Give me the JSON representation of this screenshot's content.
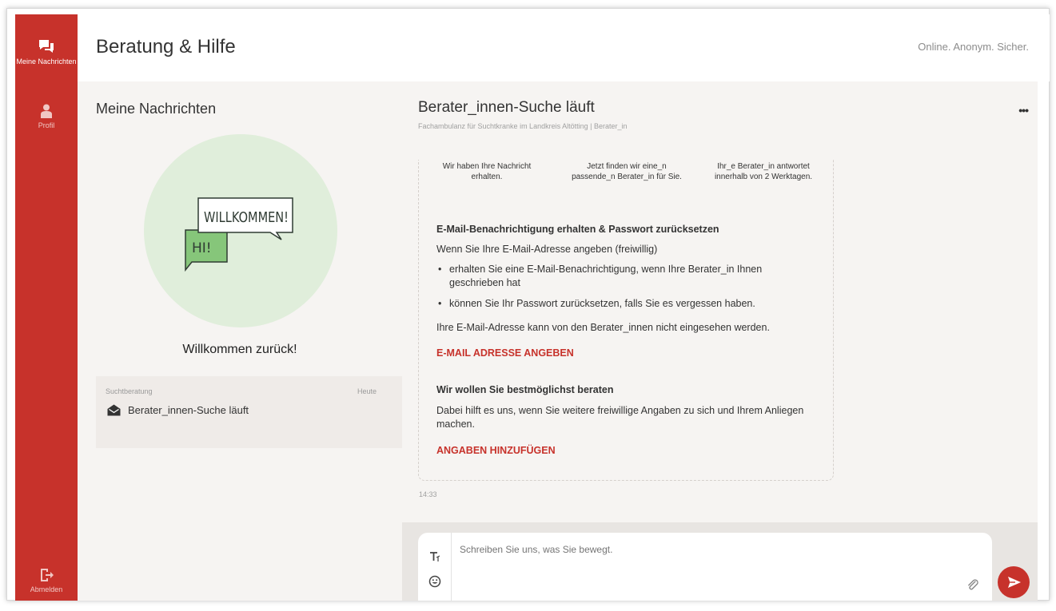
{
  "sidebar": {
    "items": [
      {
        "label": "Meine Nachrichten",
        "icon": "chat-bubbles-icon",
        "active": true
      },
      {
        "label": "Profil",
        "icon": "person-icon",
        "active": false
      }
    ],
    "logout_label": "Abmelden"
  },
  "header": {
    "title": "Beratung & Hilfe",
    "tagline": "Online. Anonym. Sicher."
  },
  "left_panel": {
    "title": "Meine Nachrichten",
    "illustration": {
      "bubble_large": "WILLKOMMEN!",
      "bubble_small": "HI!"
    },
    "welcome_text": "Willkommen zurück!",
    "session": {
      "topic": "Suchtberatung",
      "date": "Heute",
      "subject": "Berater_innen-Suche läuft"
    }
  },
  "conversation": {
    "title": "Berater_innen-Suche läuft",
    "subtitle": "Fachambulanz für Suchtkranke im Landkreis Altötting  |  Berater_in",
    "steps": [
      "Wir haben Ihre Nachricht erhalten.",
      "Jetzt finden wir eine_n passende_n Berater_in für Sie.",
      "Ihr_e Berater_in antwortet innerhalb von 2 Werktagen."
    ],
    "email_section": {
      "title": "E-Mail-Benachrichtigung erhalten & Passwort zurücksetzen",
      "intro": "Wenn Sie Ihre E-Mail-Adresse angeben (freiwillig)",
      "bullets": [
        "erhalten Sie eine E-Mail-Benachrichtigung, wenn Ihre Berater_in Ihnen geschrieben hat",
        "können Sie Ihr Passwort zurücksetzen, falls Sie es vergessen haben."
      ],
      "note": "Ihre E-Mail-Adresse kann von den Berater_innen nicht eingesehen werden.",
      "link": "E-MAIL ADRESSE ANGEBEN"
    },
    "advice_section": {
      "title": "Wir wollen Sie bestmöglichst beraten",
      "text": "Dabei hilft es uns, wenn Sie weitere freiwillige Angaben zu sich und Ihrem Anliegen machen.",
      "link": "ANGABEN HINZUFÜGEN"
    },
    "time": "14:33"
  },
  "composer": {
    "placeholder": "Schreiben Sie uns, was Sie bewegt."
  },
  "colors": {
    "brand_red": "#c7322b",
    "panel_bg": "#f6f4f2",
    "welcome_green": "#e0eedb"
  }
}
